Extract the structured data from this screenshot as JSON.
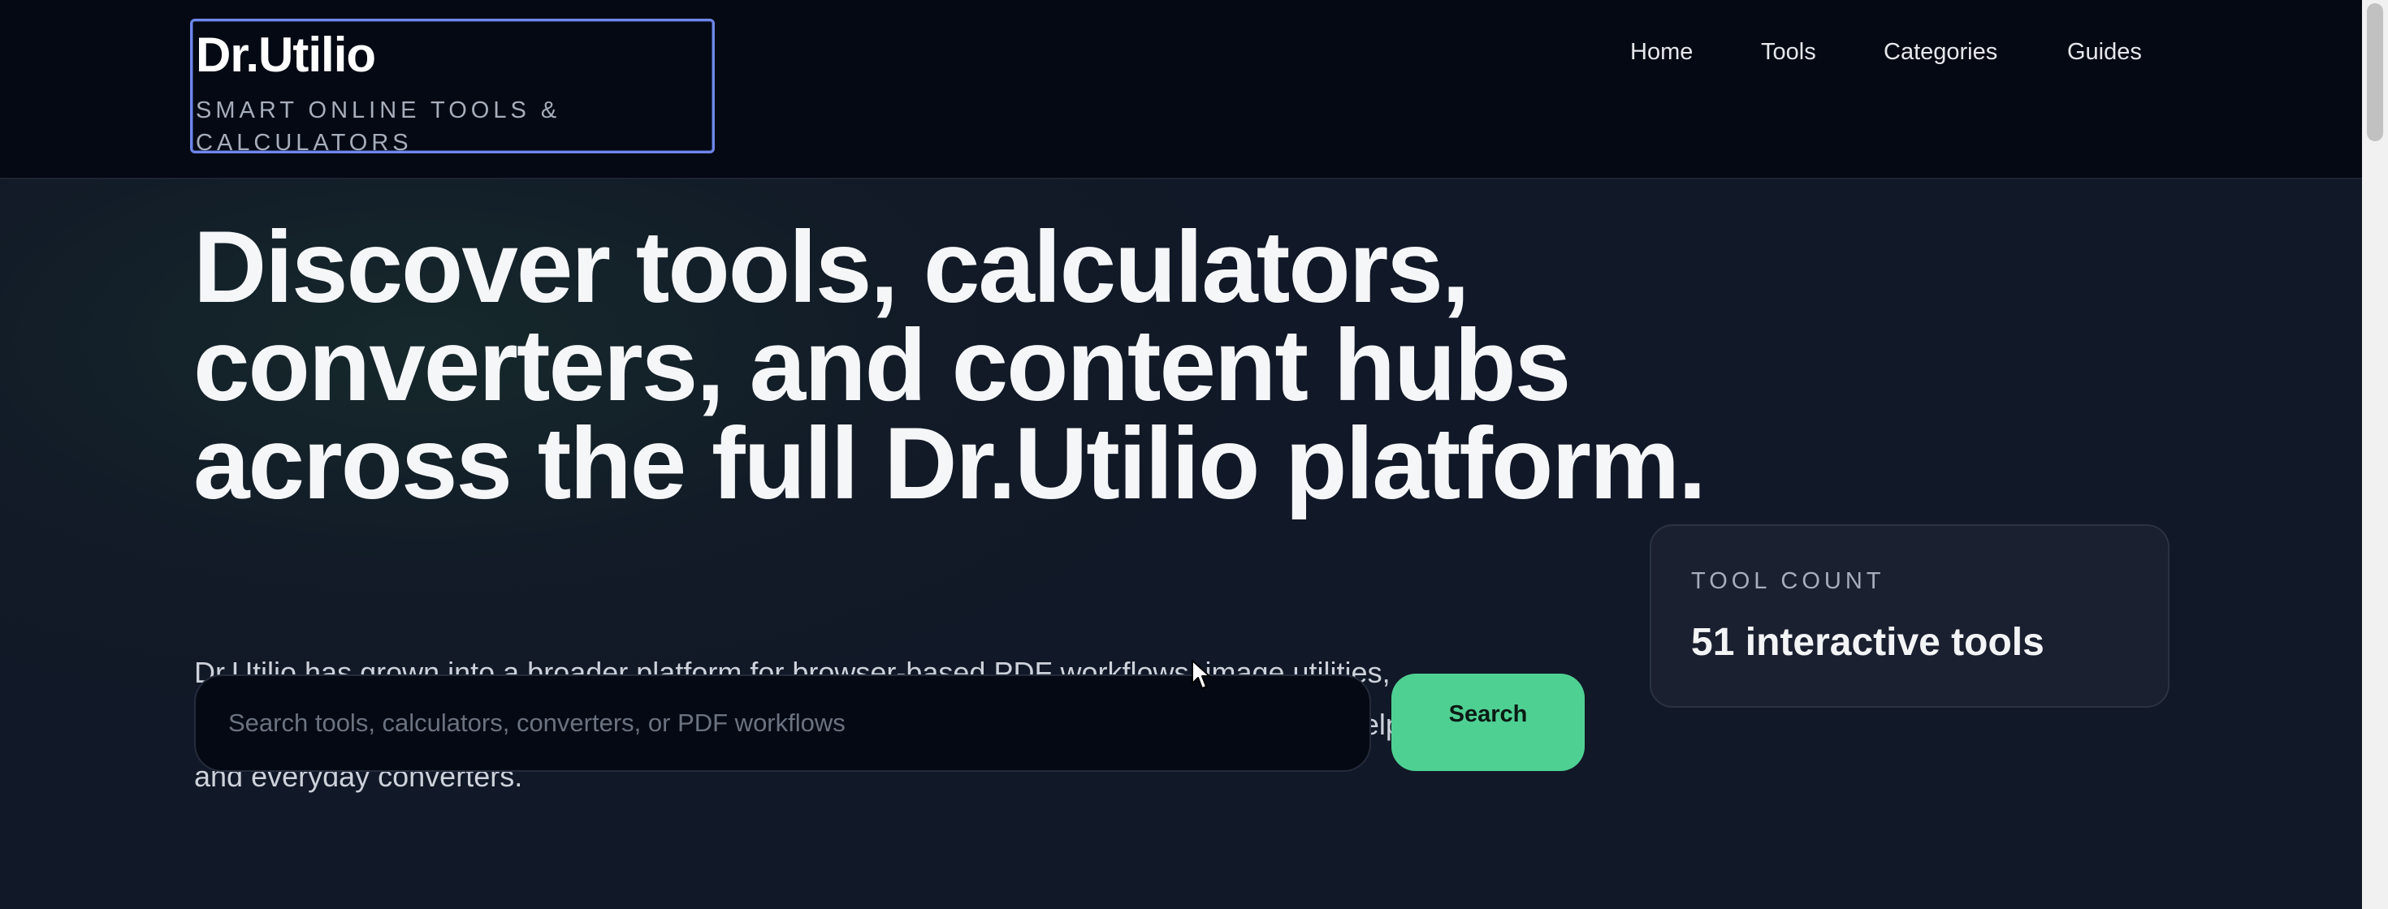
{
  "header": {
    "brand_name": "Dr.Utilio",
    "brand_tagline": "SMART ONLINE TOOLS & CALCULATORS",
    "nav": [
      {
        "label": "Home"
      },
      {
        "label": "Tools"
      },
      {
        "label": "Categories"
      },
      {
        "label": "Guides"
      }
    ]
  },
  "hero": {
    "headline": "Discover tools, calculators, converters, and content hubs across the full Dr.Utilio platform.",
    "description": "Dr.Utilio has grown into a broader platform for browser-based PDF workflows, image utilities, financial planning, tax-focused tools, retirement calculators, health references, education helpers, and everyday converters.",
    "search": {
      "placeholder": "Search tools, calculators, converters, or PDF workflows",
      "value": "",
      "button_label": "Search"
    }
  },
  "stat_card": {
    "label": "TOOL COUNT",
    "value": "51 interactive tools"
  },
  "colors": {
    "accent": "#4fd093",
    "header_bg": "#050913",
    "page_bg": "#111827",
    "focus_ring": "#6d86e8"
  }
}
